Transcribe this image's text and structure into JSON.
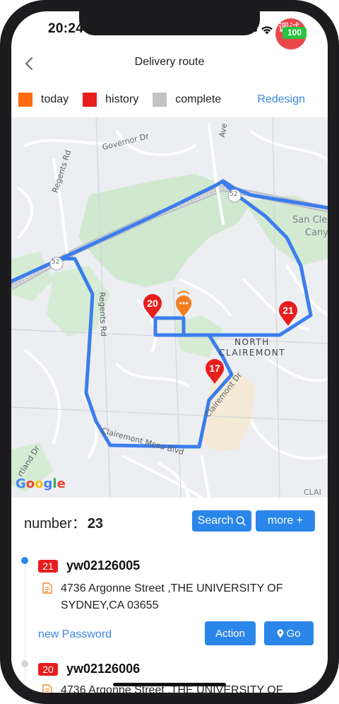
{
  "status_bar": {
    "time": "20:24",
    "battery": "100",
    "overlay_text": "调试"
  },
  "nav": {
    "title": "Delivery route"
  },
  "legend": {
    "items": [
      {
        "label": "today",
        "color": "#ff6a13"
      },
      {
        "label": "history",
        "color": "#e81d1d"
      },
      {
        "label": "complete",
        "color": "#c3c3c3"
      }
    ],
    "redesign": "Redesign"
  },
  "map": {
    "labels": {
      "governor": "Governor Dr",
      "regents_top": "Regents Rd",
      "regents_left": "Regents Rd",
      "ave": "Ave",
      "route52_a": "52",
      "route52_b": "52",
      "san_cle": "San Cle",
      "canyon": "Cany",
      "north": "NORTH",
      "clairemont": "CLAIREMONT",
      "clairemont_dr": "Clairemont Dr",
      "clairemont_mesa": "Clairemont Mesa Blvd",
      "rtland": "rtland Dr",
      "clai": "CLAI"
    },
    "google": "Google",
    "pins": [
      {
        "number": "20",
        "color": "#e81d1d"
      },
      {
        "number": "21",
        "color": "#e81d1d"
      },
      {
        "number": "17",
        "color": "#e81d1d"
      }
    ],
    "current_pin_color": "#f47c20",
    "route_color": "#3b7ded"
  },
  "list": {
    "count_label": "number：",
    "count_value": "23",
    "search_label": "Search",
    "more_label": "more +",
    "orders": [
      {
        "badge": "21",
        "id": "yw02126005",
        "address": "4736 Argonne Street ,THE UNIVERSITY OF SYDNEY,CA 03655",
        "password_link": "new Password",
        "action_label": "Action",
        "go_label": "Go"
      },
      {
        "badge": "20",
        "id": "yw02126006",
        "address": "4736 Argonne Street ,THE UNIVERSITY OF"
      }
    ]
  }
}
